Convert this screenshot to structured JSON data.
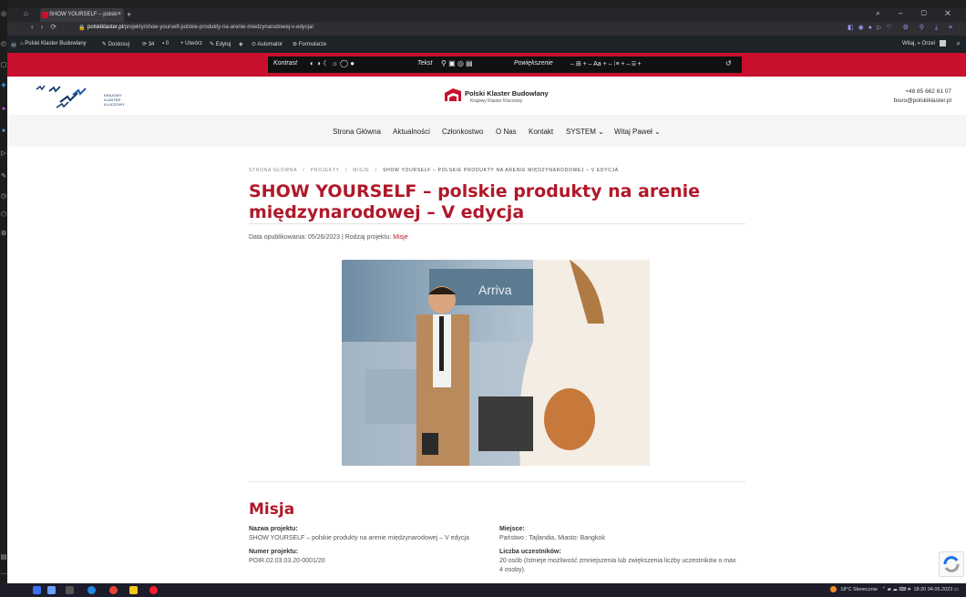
{
  "browser": {
    "tab_title": "SHOW YOURSELF – polski",
    "tab_close": "×",
    "new_tab": "+",
    "url_domain": "polskiklaster.pl",
    "url_path": "/projekty/show-yourself-polskie-produkty-na-arenie-miedzynarodowej-v-edycja/"
  },
  "wp_admin": {
    "site_name": "Polski Klaster Budowlany",
    "customize": "Dostosuj",
    "updates": "34",
    "comments": "0",
    "new": "Utwórz",
    "edit": "Edytuj",
    "automator": "Automator",
    "forms": "Formularze",
    "greeting": "Witaj, » Orzel"
  },
  "a11y": {
    "contrast": "Kontrast",
    "text": "Tekst",
    "zoom": "Powiększenie",
    "zoom_controls": "– ⊞ +   – Aa +   – ⁞≡ +   – ⌸ +"
  },
  "header": {
    "left_logo_text": [
      "KRAJOWY",
      "KLASTER",
      "KLUCZOWY"
    ],
    "center_logo_name": "Polski Klaster Budowlany",
    "center_logo_sub": "Krajowy Klaster Kluczowy",
    "phone": "+48 85 662 61 07",
    "email": "biuro@polskiklaster.pl"
  },
  "menu": {
    "items": [
      "Strona Główna",
      "Aktualności",
      "Członkostwo",
      "O Nas",
      "Kontakt",
      "SYSTEM ⌄",
      "Witaj Paweł ⌄"
    ]
  },
  "page": {
    "breadcrumb": [
      "STRONA GŁÓWNA",
      "PROJEKTY",
      "MISJE"
    ],
    "breadcrumb_sep": "/",
    "breadcrumb_current": "SHOW YOURSELF – POLSKIE PRODUKTY NA ARENIE MIĘDZYNARODOWEJ – V EDYCJA",
    "title_line1": "SHOW YOURSELF – polskie produkty na arenie",
    "title_line2": "międzynarodowej – V edycja",
    "meta_prefix": "Data opublikowania: 05/26/2023 | Rodzaj projektu:",
    "meta_type": "Misje",
    "photo_sign": "Arriva",
    "section_title": "Misja",
    "left_fields": [
      {
        "label": "Nazwa projektu:",
        "value": "SHOW YOURSELF – polskie produkty na arenie międzynarodowej – V edycja"
      },
      {
        "label": "Numer projektu:",
        "value": "POIR.02.03.03.20-0001/20"
      }
    ],
    "right_fields": [
      {
        "label": "Miejsce:",
        "value": "Państwo : Tajlandia, Miasto: Bangkok"
      },
      {
        "label": "Liczba uczestników:",
        "value": "20 osób (Istnieje możliwość zmniejszenia lub zwiększenia liczby uczestników o max 4 osoby)."
      }
    ]
  },
  "taskbar": {
    "weather": "18°C  Słonecznie",
    "time": "18:20",
    "date": "04.06.2023"
  }
}
